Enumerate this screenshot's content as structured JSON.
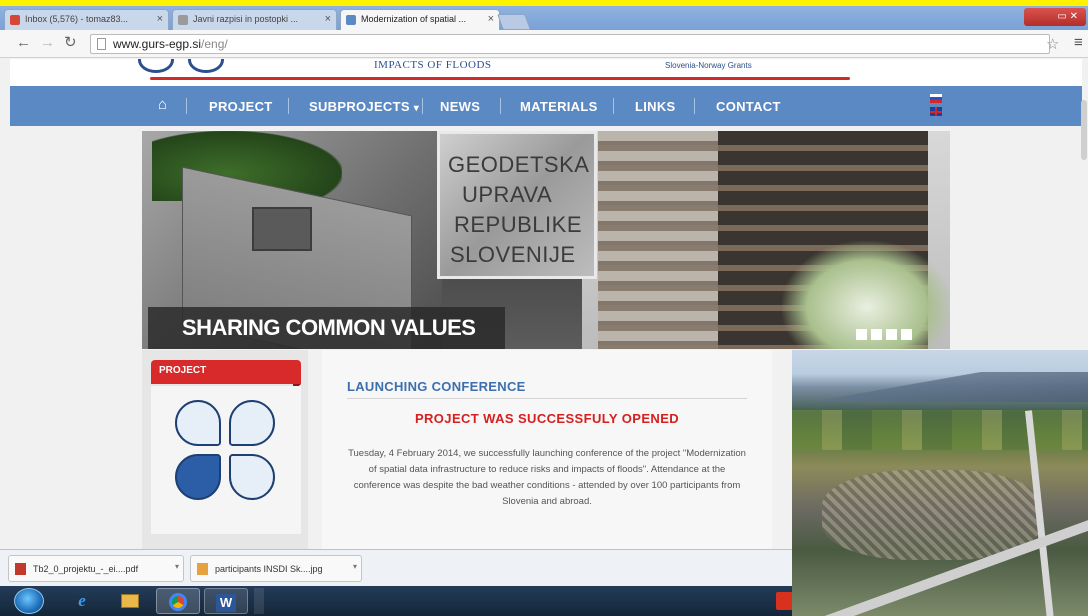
{
  "browser": {
    "tabs": [
      {
        "label": "Inbox (5,576) - tomaz83...",
        "color": "#d44638"
      },
      {
        "label": "Javni razpisi in postopki ...",
        "color": "#9a9a9a"
      },
      {
        "label": "Modernization of spatial ...",
        "color": "#5b89c4",
        "active": true
      }
    ],
    "tab_close_glyph": "×",
    "url_host": "www.gurs-egp.si",
    "url_path": "/eng/",
    "window_controls": "▭ ✕"
  },
  "site": {
    "header_title": "IMPACTS OF FLOODS",
    "header_subtitle": "Slovenia-Norway Grants",
    "nav": {
      "home_icon": "home-icon",
      "items": [
        "PROJECT",
        "SUBPROJECTS",
        "NEWS",
        "MATERIALS",
        "LINKS",
        "CONTACT"
      ],
      "subprojects_arrow": "▾"
    },
    "slider": {
      "caption": "SHARING COMMON VALUES",
      "sign_lines": [
        "GEODETSKA",
        "UPRAVA",
        "REPUBLIKE",
        "SLOVENIJE"
      ],
      "dots": 4
    },
    "sidebar": {
      "tab_label": "PROJECT"
    },
    "news": {
      "heading": "LAUNCHING CONFERENCE",
      "subheading": "PROJECT WAS SUCCESSFULY OPENED",
      "body": "Tuesday, 4 February 2014, we successfully launching conference of the project \"Modernization of spatial data infrastructure to reduce risks and impacts of floods\". Attendance at the conference was despite the bad weather conditions - attended by over 100 participants from Slovenia and abroad."
    }
  },
  "downloads": [
    {
      "label": "Tb2_0_projektu_-_ei....pdf",
      "icon": "pdf-icon",
      "color": "#c0392b"
    },
    {
      "label": "participants INSDI Sk....jpg",
      "icon": "image-icon",
      "color": "#e6a23c"
    }
  ],
  "download_arrow": "▾",
  "colors": {
    "nav_bar": "#5b89c4",
    "accent_red": "#d82a2a",
    "heading_blue": "#3d6fae",
    "highlight_yellow": "#fff200"
  }
}
